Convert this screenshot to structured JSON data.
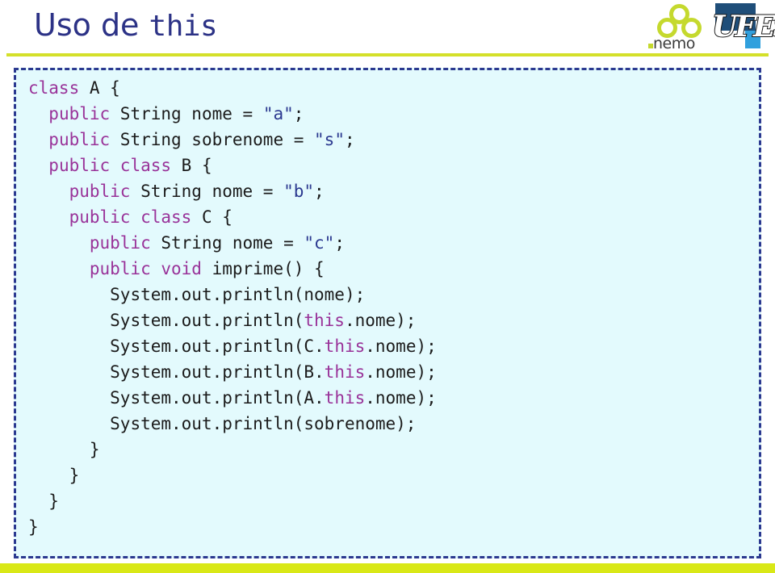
{
  "slide": {
    "title_plain": "Uso de ",
    "title_mono": "this",
    "accent_green": "#d4e02a",
    "accent_navy": "#2b3990",
    "code_bg": "#e3fafd",
    "keyword_color": "#993399",
    "string_color": "#2b3990",
    "bottom_bar_color": "#d9e817"
  },
  "logos": {
    "nemo": {
      "label": "nemo",
      "circle_color": "#c5d92e",
      "text_color": "#3b3b3b"
    },
    "ufes": {
      "label": "UFES",
      "navy": "#1f4e79",
      "light_blue": "#31a0dd"
    }
  },
  "code": {
    "language": "java",
    "lines": [
      {
        "indent": 0,
        "tokens": [
          {
            "t": "kw",
            "v": "class"
          },
          {
            "t": "pl",
            "v": " A {"
          }
        ]
      },
      {
        "indent": 1,
        "tokens": [
          {
            "t": "kw",
            "v": "public"
          },
          {
            "t": "pl",
            "v": " String nome = "
          },
          {
            "t": "str",
            "v": "\"a\""
          },
          {
            "t": "pl",
            "v": ";"
          }
        ]
      },
      {
        "indent": 1,
        "tokens": [
          {
            "t": "kw",
            "v": "public"
          },
          {
            "t": "pl",
            "v": " String sobrenome = "
          },
          {
            "t": "str",
            "v": "\"s\""
          },
          {
            "t": "pl",
            "v": ";"
          }
        ]
      },
      {
        "indent": 1,
        "tokens": [
          {
            "t": "kw",
            "v": "public class"
          },
          {
            "t": "pl",
            "v": " B {"
          }
        ]
      },
      {
        "indent": 2,
        "tokens": [
          {
            "t": "kw",
            "v": "public"
          },
          {
            "t": "pl",
            "v": " String nome = "
          },
          {
            "t": "str",
            "v": "\"b\""
          },
          {
            "t": "pl",
            "v": ";"
          }
        ]
      },
      {
        "indent": 2,
        "tokens": [
          {
            "t": "kw",
            "v": "public class"
          },
          {
            "t": "pl",
            "v": " C {"
          }
        ]
      },
      {
        "indent": 3,
        "tokens": [
          {
            "t": "kw",
            "v": "public"
          },
          {
            "t": "pl",
            "v": " String nome = "
          },
          {
            "t": "str",
            "v": "\"c\""
          },
          {
            "t": "pl",
            "v": ";"
          }
        ]
      },
      {
        "indent": 3,
        "tokens": [
          {
            "t": "kw",
            "v": "public void"
          },
          {
            "t": "pl",
            "v": " imprime() {"
          }
        ]
      },
      {
        "indent": 4,
        "tokens": [
          {
            "t": "pl",
            "v": "System.out.println(nome);"
          }
        ]
      },
      {
        "indent": 4,
        "tokens": [
          {
            "t": "pl",
            "v": "System.out.println("
          },
          {
            "t": "kw",
            "v": "this"
          },
          {
            "t": "pl",
            "v": ".nome);"
          }
        ]
      },
      {
        "indent": 4,
        "tokens": [
          {
            "t": "pl",
            "v": "System.out.println(C."
          },
          {
            "t": "kw",
            "v": "this"
          },
          {
            "t": "pl",
            "v": ".nome);"
          }
        ]
      },
      {
        "indent": 4,
        "tokens": [
          {
            "t": "pl",
            "v": "System.out.println(B."
          },
          {
            "t": "kw",
            "v": "this"
          },
          {
            "t": "pl",
            "v": ".nome);"
          }
        ]
      },
      {
        "indent": 4,
        "tokens": [
          {
            "t": "pl",
            "v": "System.out.println(A."
          },
          {
            "t": "kw",
            "v": "this"
          },
          {
            "t": "pl",
            "v": ".nome);"
          }
        ]
      },
      {
        "indent": 4,
        "tokens": [
          {
            "t": "pl",
            "v": "System.out.println(sobrenome);"
          }
        ]
      },
      {
        "indent": 3,
        "tokens": [
          {
            "t": "pl",
            "v": "}"
          }
        ]
      },
      {
        "indent": 2,
        "tokens": [
          {
            "t": "pl",
            "v": "}"
          }
        ]
      },
      {
        "indent": 1,
        "tokens": [
          {
            "t": "pl",
            "v": "}"
          }
        ]
      },
      {
        "indent": 0,
        "tokens": [
          {
            "t": "pl",
            "v": "}"
          }
        ]
      }
    ]
  }
}
